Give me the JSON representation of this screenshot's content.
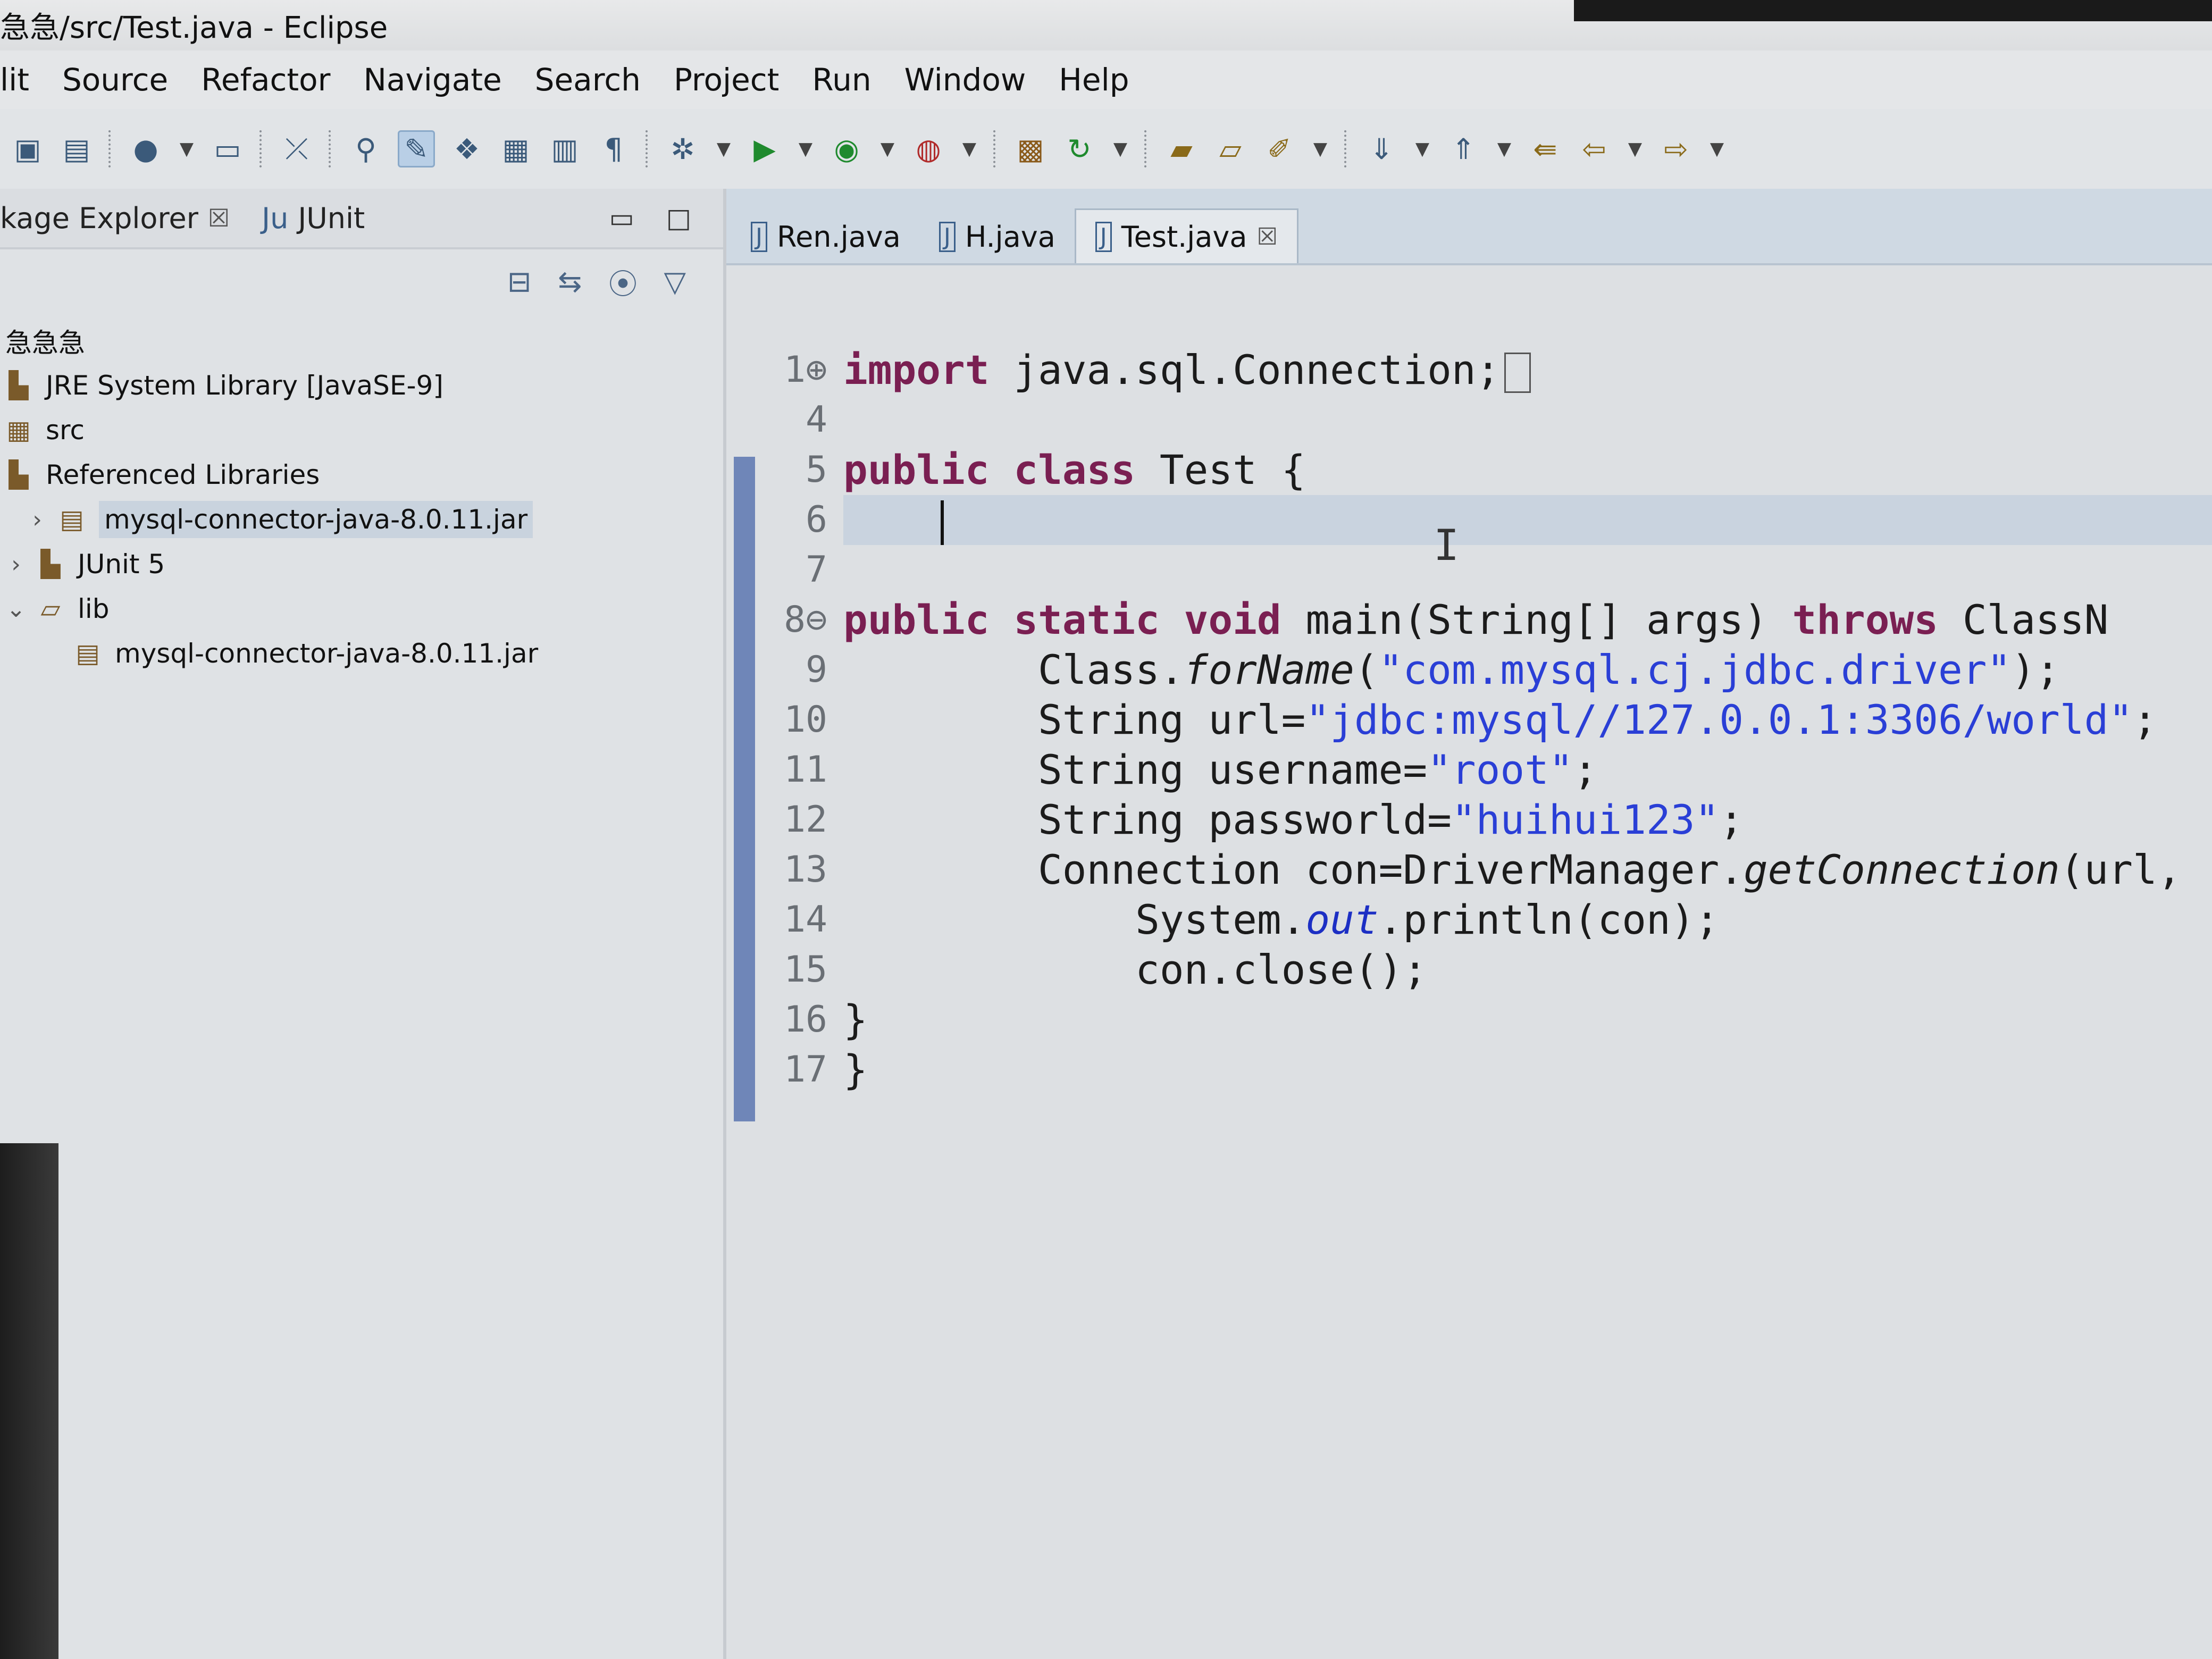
{
  "window": {
    "title": "急急/src/Test.java - Eclipse"
  },
  "menu": {
    "items": [
      "lit",
      "Source",
      "Refactor",
      "Navigate",
      "Search",
      "Project",
      "Run",
      "Window",
      "Help"
    ]
  },
  "toolbar": {
    "icons": [
      "save-icon",
      "save-all-icon",
      "profile-icon",
      "console-icon",
      "skip-breakpoints-icon",
      "pin-icon",
      "highlight-icon",
      "mark-occurrences-icon",
      "toggle-block-icon",
      "toggle-whitespace-icon",
      "paragraph-icon",
      "debug-icon",
      "run-icon",
      "coverage-icon",
      "run-last-icon",
      "new-package-icon",
      "refresh-icon",
      "open-type-icon",
      "open-folder-icon",
      "search-icon",
      "next-annotation-icon",
      "prev-annotation-icon",
      "last-edit-icon",
      "back-icon",
      "forward-icon"
    ]
  },
  "explorer": {
    "tabs": [
      {
        "label": "kage Explorer",
        "close": "☒"
      },
      {
        "label": "JUnit",
        "prefix": "Ju"
      }
    ],
    "tree": [
      {
        "label": "急急急",
        "level": 0
      },
      {
        "label": "JRE System Library [JavaSE-9]",
        "level": 0
      },
      {
        "label": "src",
        "level": 0
      },
      {
        "label": "Referenced Libraries",
        "level": 0
      },
      {
        "label": "mysql-connector-java-8.0.11.jar",
        "level": 1,
        "selected": true
      },
      {
        "label": "JUnit 5",
        "level": 0
      },
      {
        "label": "lib",
        "level": 0
      },
      {
        "label": "mysql-connector-java-8.0.11.jar",
        "level": 2
      }
    ]
  },
  "editor": {
    "tabs": [
      {
        "label": "Ren.java",
        "active": false
      },
      {
        "label": "H.java",
        "active": false
      },
      {
        "label": "Test.java",
        "active": true,
        "close": "☒"
      }
    ],
    "line_numbers": [
      "1⊕",
      "4",
      "5",
      "6",
      "7",
      "8⊖",
      "9",
      "10",
      "11",
      "12",
      "13",
      "14",
      "15",
      "16",
      "17"
    ],
    "code": {
      "l1_kw": "import",
      "l1_rest": " java.sql.Connection;",
      "l5_kw1": "public",
      "l5_kw2": "class",
      "l5_rest": " Test {",
      "l8_kw1": "public",
      "l8_kw2": "static",
      "l8_kw3": "void",
      "l8_mid": " main(String[] args) ",
      "l8_kw4": "throws",
      "l8_end": " ClassN",
      "l9_a": "        Class.",
      "l9_m": "forName",
      "l9_b": "(",
      "l9_s": "\"com.mysql.cj.jdbc.driver\"",
      "l9_c": ");",
      "l10_a": "        String url=",
      "l10_s": "\"jdbc:mysql//127.0.0.1:3306/world\"",
      "l10_c": ";",
      "l11_a": "        String username=",
      "l11_s": "\"root\"",
      "l11_c": ";",
      "l12_a": "        String passworld=",
      "l12_s": "\"huihui123\"",
      "l12_c": ";",
      "l13_a": "        Connection con=DriverManager.",
      "l13_m": "getConnection",
      "l13_c": "(url,",
      "l14_a": "            System.",
      "l14_f": "out",
      "l14_c": ".println(con);",
      "l15": "            con.close();",
      "l16": "}",
      "l17": "}"
    }
  }
}
